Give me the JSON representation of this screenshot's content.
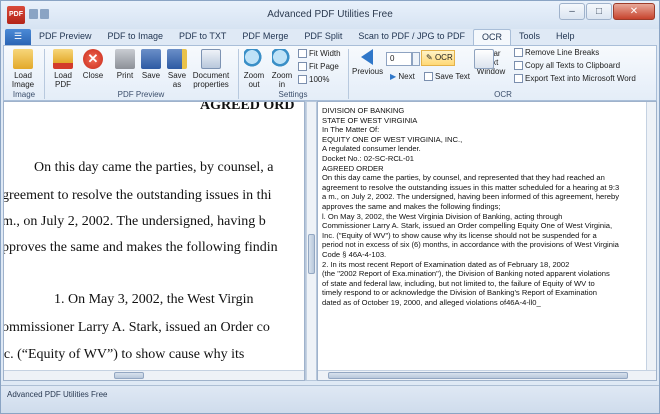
{
  "window": {
    "title": "Advanced PDF Utilities Free"
  },
  "tabs": [
    "PDF Preview",
    "PDF to Image",
    "PDF to TXT",
    "PDF Merge",
    "PDF Split",
    "Scan to PDF / JPG to PDF",
    "OCR",
    "Tools",
    "Help"
  ],
  "active_tab": "OCR",
  "ribbon": {
    "load_image": "Load Image",
    "group_image": "Image",
    "load_pdf": "Load PDF",
    "close": "Close",
    "print": "Print",
    "save": "Save",
    "save_as": "Save as",
    "doc_props": "Document properties",
    "group_preview": "PDF Preview",
    "zoom_out": "Zoom out",
    "zoom_in": "Zoom in",
    "fit_width": "Fit Width",
    "fit_page": "Fit Page",
    "zoom_100": "100%",
    "group_settings": "Settings",
    "previous": "Previous",
    "page_value": "0",
    "next": "Next",
    "ocr": "OCR",
    "save_text": "Save Text",
    "clear_text": "Clear Text Window",
    "remove_line_breaks": "Remove Line Breaks",
    "copy_all": "Copy all Texts to Clipboard",
    "export_word": "Export Text into Microsoft Word",
    "group_ocr": "OCR"
  },
  "document": {
    "heading": "AGREED ORD",
    "lines": [
      "On this day came the parties, by counsel, a",
      "greement to resolve the outstanding issues in thi",
      "m., on July 2, 2002.  The undersigned, having b",
      "pproves the same and makes the following findin",
      "1.        On May 3, 2002, the West Virgin",
      "ommissioner Larry A. Stark, issued an Order co",
      "ıc. (“Equity of WV”) to show cause why its"
    ]
  },
  "ocr_text": [
    "DIVISION OF BANKING",
    "STATE OF WEST VIRGINIA",
    "In The Matter Of:",
    "EQUITY ONE OF WEST VIRGINIA, INC.,",
    "A regulated consumer lender.",
    "Docket No.: 02-SC-RCL-01",
    "AGREED ORDER",
    "On this day came the parties, by counsel, and represented that they had reached an",
    "agreement to resolve the outstanding issues in this matter scheduled for a hearing at 9:3",
    "a m., on July 2, 2002. The undersigned, having been informed of this agreement, hereby",
    "approves the same and makes the following findings;",
    "l. On May 3, 2002, the West Virginia Division of Banking, acting through",
    "Commissioner Larry A. Stark, issued an Order compelling Equity One of West Virginia,",
    "Inc. (\"Equity of WV\") to show cause why its license should not be suspended for a",
    "period not in excess of six (6) months, in accordance with the provisions of West Virginia",
    "Code § 46A-4-103.",
    "2. In its most recent Report of Examination dated as of February 18, 2002",
    "(the \"2002 Report of Exa.mination\"), the Division of Banking noted apparent violations",
    "of state and federal law, including, but not limited to, the failure of Equity of WV to",
    "timely respond to or acknowledge the Division of Banking's Report of Examination",
    "dated as of October 19, 2000, and alleged violations of46A-4-ll0_"
  ],
  "status": "Advanced PDF Utilities Free",
  "icons": {
    "app": "pdf-app-icon",
    "close": "close-icon",
    "print": "printer-icon",
    "save": "floppy-icon",
    "zoom": "magnifier-icon",
    "previous": "arrow-left-icon",
    "next": "arrow-right-icon"
  },
  "colors": {
    "accent": "#2b65b5",
    "ocr_highlight": "#ffd875",
    "close_button": "#c7432d"
  }
}
